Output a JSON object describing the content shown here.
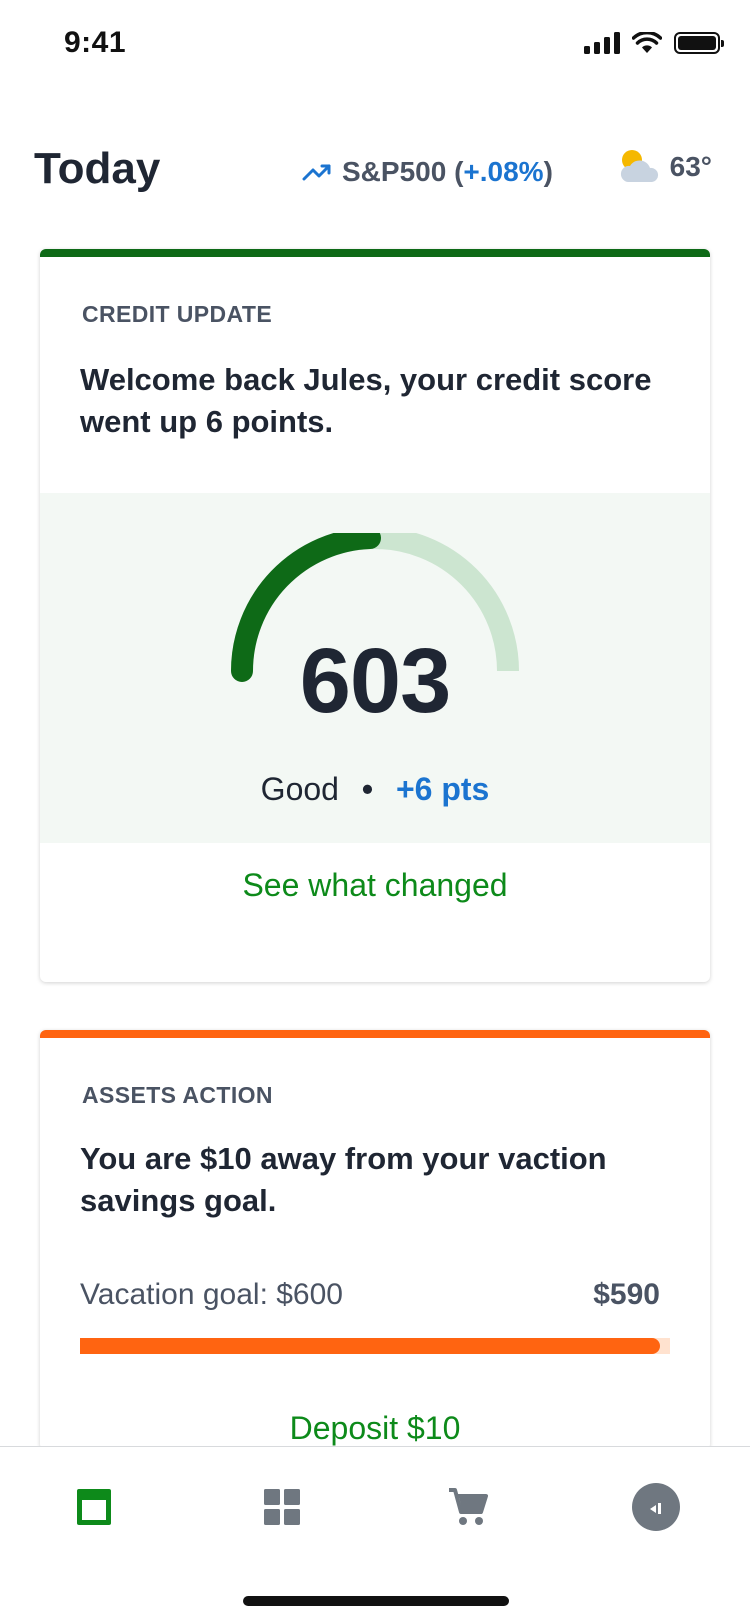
{
  "status_bar": {
    "time": "9:41"
  },
  "header": {
    "title": "Today",
    "market": {
      "label": "S&P500",
      "open_paren": "(",
      "change": "+.08%",
      "close_paren": ")"
    },
    "weather": {
      "temp": "63°"
    }
  },
  "credit_card": {
    "eyebrow": "CREDIT UPDATE",
    "headline": "Welcome back Jules, your credit score went up 6 points.",
    "score": "603",
    "rating": "Good",
    "separator": "•",
    "delta": "+6 pts",
    "cta": "See what changed"
  },
  "assets_card": {
    "eyebrow": "ASSETS ACTION",
    "headline": "You are $10 away from your vaction savings goal.",
    "goal_label": "Vacation goal: $600",
    "current_amount": "$590",
    "progress": 0.9833,
    "cta": "Deposit $10"
  },
  "tab_bar": {
    "tabs": [
      {
        "icon": "today-card-icon",
        "active": true
      },
      {
        "icon": "grid-icon",
        "active": false
      },
      {
        "icon": "cart-icon",
        "active": false
      },
      {
        "icon": "profile-icon",
        "active": false
      }
    ]
  },
  "colors": {
    "credit_accent": "#0e6a17",
    "assets_accent": "#ff6411",
    "link_blue": "#1b74d0",
    "cta_green": "#0d8a1a"
  }
}
